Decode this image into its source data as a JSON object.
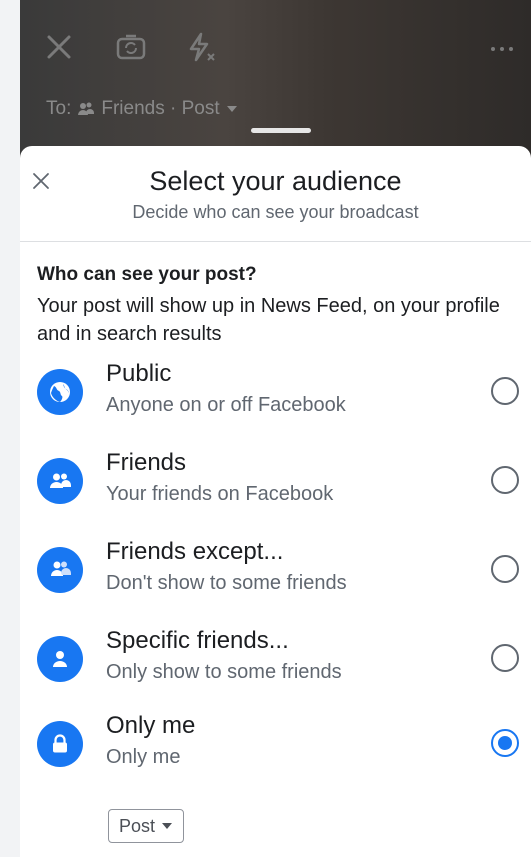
{
  "camera": {
    "to_label": "To:",
    "audience_label": "Friends · Post"
  },
  "sheet": {
    "title": "Select your audience",
    "subtitle": "Decide who can see your broadcast"
  },
  "question": {
    "title": "Who can see your post?",
    "description": "Your post will show up in News Feed, on your profile and in search results"
  },
  "options": [
    {
      "label": "Public",
      "sublabel": "Anyone on or off Facebook",
      "icon": "globe-icon",
      "selected": false
    },
    {
      "label": "Friends",
      "sublabel": "Your friends on Facebook",
      "icon": "friends-icon",
      "selected": false
    },
    {
      "label": "Friends except...",
      "sublabel": "Don't show to some friends",
      "icon": "friends-except-icon",
      "selected": false
    },
    {
      "label": "Specific friends...",
      "sublabel": "Only show to some friends",
      "icon": "person-icon",
      "selected": false
    },
    {
      "label": "Only me",
      "sublabel": "Only me",
      "icon": "lock-icon",
      "selected": true
    }
  ],
  "post_dropdown": {
    "label": "Post"
  },
  "colors": {
    "accent": "#1877f2",
    "text": "#1c1e21",
    "secondary_text": "#606770"
  }
}
